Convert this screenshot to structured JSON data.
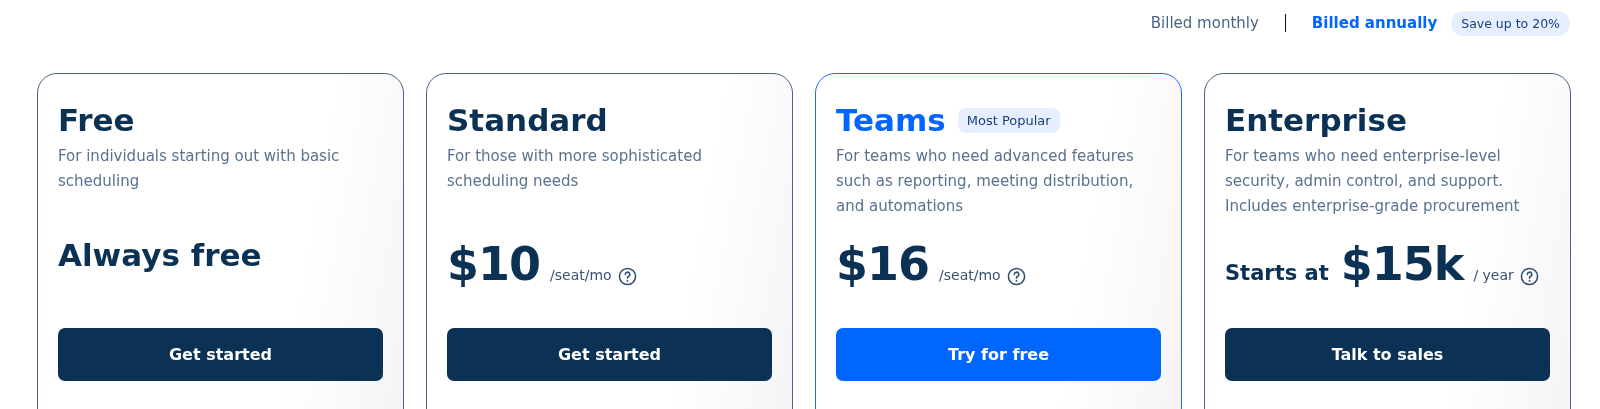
{
  "billing": {
    "options": [
      {
        "label": "Billed monthly",
        "selected": false
      },
      {
        "label": "Billed annually",
        "selected": true
      }
    ],
    "badge": "Save up to 20%"
  },
  "plans": [
    {
      "name": "Free",
      "featured": false,
      "description": "For individuals starting out with basic scheduling",
      "price": {
        "kind": "text",
        "text": "Always free"
      },
      "button": "Get started"
    },
    {
      "name": "Standard",
      "featured": false,
      "description": "For those with more sophisticated scheduling needs",
      "price": {
        "kind": "amount",
        "amount": "$10",
        "unit": "/seat/mo"
      },
      "button": "Get started"
    },
    {
      "name": "Teams",
      "featured": true,
      "badge": "Most Popular",
      "description": "For teams who need advanced features such as reporting, meeting distribution, and automations",
      "price": {
        "kind": "amount",
        "amount": "$16",
        "unit": "/seat/mo"
      },
      "button": "Try for free"
    },
    {
      "name": "Enterprise",
      "featured": false,
      "description": "For teams who need enterprise-level security, admin control, and support. Includes enterprise-grade procurement",
      "price": {
        "kind": "amount",
        "prefix": "Starts at",
        "amount": "$15k",
        "unit": "/ year"
      },
      "button": "Talk to sales"
    }
  ]
}
